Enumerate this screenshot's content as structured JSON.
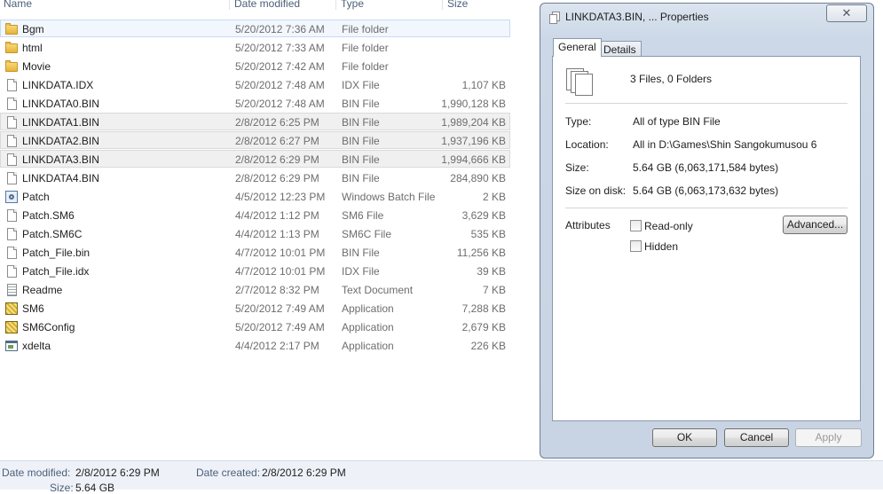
{
  "columns": {
    "name": "Name",
    "date": "Date modified",
    "type": "Type",
    "size": "Size"
  },
  "files": [
    {
      "name": "Bgm",
      "date": "5/20/2012 7:36 AM",
      "type": "File folder",
      "size": "",
      "icon": "folder-icon",
      "state": "hover"
    },
    {
      "name": "html",
      "date": "5/20/2012 7:33 AM",
      "type": "File folder",
      "size": "",
      "icon": "folder-icon",
      "state": ""
    },
    {
      "name": "Movie",
      "date": "5/20/2012 7:42 AM",
      "type": "File folder",
      "size": "",
      "icon": "folder-icon",
      "state": ""
    },
    {
      "name": "LINKDATA.IDX",
      "date": "5/20/2012 7:48 AM",
      "type": "IDX File",
      "size": "1,107 KB",
      "icon": "file-icon",
      "state": ""
    },
    {
      "name": "LINKDATA0.BIN",
      "date": "5/20/2012 7:48 AM",
      "type": "BIN File",
      "size": "1,990,128 KB",
      "icon": "file-icon",
      "state": ""
    },
    {
      "name": "LINKDATA1.BIN",
      "date": "2/8/2012 6:25 PM",
      "type": "BIN File",
      "size": "1,989,204 KB",
      "icon": "file-icon",
      "state": "selected"
    },
    {
      "name": "LINKDATA2.BIN",
      "date": "2/8/2012 6:27 PM",
      "type": "BIN File",
      "size": "1,937,196 KB",
      "icon": "file-icon",
      "state": "selected"
    },
    {
      "name": "LINKDATA3.BIN",
      "date": "2/8/2012 6:29 PM",
      "type": "BIN File",
      "size": "1,994,666 KB",
      "icon": "file-icon",
      "state": "selected"
    },
    {
      "name": "LINKDATA4.BIN",
      "date": "2/8/2012 6:29 PM",
      "type": "BIN File",
      "size": "284,890 KB",
      "icon": "file-icon",
      "state": ""
    },
    {
      "name": "Patch",
      "date": "4/5/2012 12:23 PM",
      "type": "Windows Batch File",
      "size": "2 KB",
      "icon": "batch-file-icon",
      "state": ""
    },
    {
      "name": "Patch.SM6",
      "date": "4/4/2012 1:12 PM",
      "type": "SM6 File",
      "size": "3,629 KB",
      "icon": "file-icon",
      "state": ""
    },
    {
      "name": "Patch.SM6C",
      "date": "4/4/2012 1:13 PM",
      "type": "SM6C File",
      "size": "535 KB",
      "icon": "file-icon",
      "state": ""
    },
    {
      "name": "Patch_File.bin",
      "date": "4/7/2012 10:01 PM",
      "type": "BIN File",
      "size": "11,256 KB",
      "icon": "file-icon",
      "state": ""
    },
    {
      "name": "Patch_File.idx",
      "date": "4/7/2012 10:01 PM",
      "type": "IDX File",
      "size": "39 KB",
      "icon": "file-icon",
      "state": ""
    },
    {
      "name": "Readme",
      "date": "2/7/2012 8:32 PM",
      "type": "Text Document",
      "size": "7 KB",
      "icon": "text-document-icon",
      "state": ""
    },
    {
      "name": "SM6",
      "date": "5/20/2012 7:49 AM",
      "type": "Application",
      "size": "7,288 KB",
      "icon": "application-icon",
      "state": ""
    },
    {
      "name": "SM6Config",
      "date": "5/20/2012 7:49 AM",
      "type": "Application",
      "size": "2,679 KB",
      "icon": "application-icon",
      "state": ""
    },
    {
      "name": "xdelta",
      "date": "4/4/2012 2:17 PM",
      "type": "Application",
      "size": "226 KB",
      "icon": "window-application-icon",
      "state": ""
    }
  ],
  "details_pane": {
    "modified_label": "Date modified:",
    "modified_value": "2/8/2012 6:29 PM",
    "created_label": "Date created:",
    "created_value": "2/8/2012 6:29 PM",
    "size_label": "Size:",
    "size_value": "5.64 GB"
  },
  "dialog": {
    "title": "LINKDATA3.BIN, ... Properties",
    "close_label": "✕",
    "tabs": [
      {
        "label": "General",
        "active": true
      },
      {
        "label": "Details",
        "active": false
      }
    ],
    "summary": "3 Files, 0 Folders",
    "props": {
      "type_label": "Type:",
      "type_value": "All of type BIN File",
      "location_label": "Location:",
      "location_value": "All in D:\\Games\\Shin Sangokumusou 6",
      "size_label": "Size:",
      "size_value": "5.64 GB (6,063,171,584 bytes)",
      "disk_label": "Size on disk:",
      "disk_value": "5.64 GB (6,063,173,632 bytes)"
    },
    "attributes_label": "Attributes",
    "readonly_label": "Read-only",
    "hidden_label": "Hidden",
    "advanced_label": "Advanced...",
    "ok_label": "OK",
    "cancel_label": "Cancel",
    "apply_label": "Apply"
  }
}
